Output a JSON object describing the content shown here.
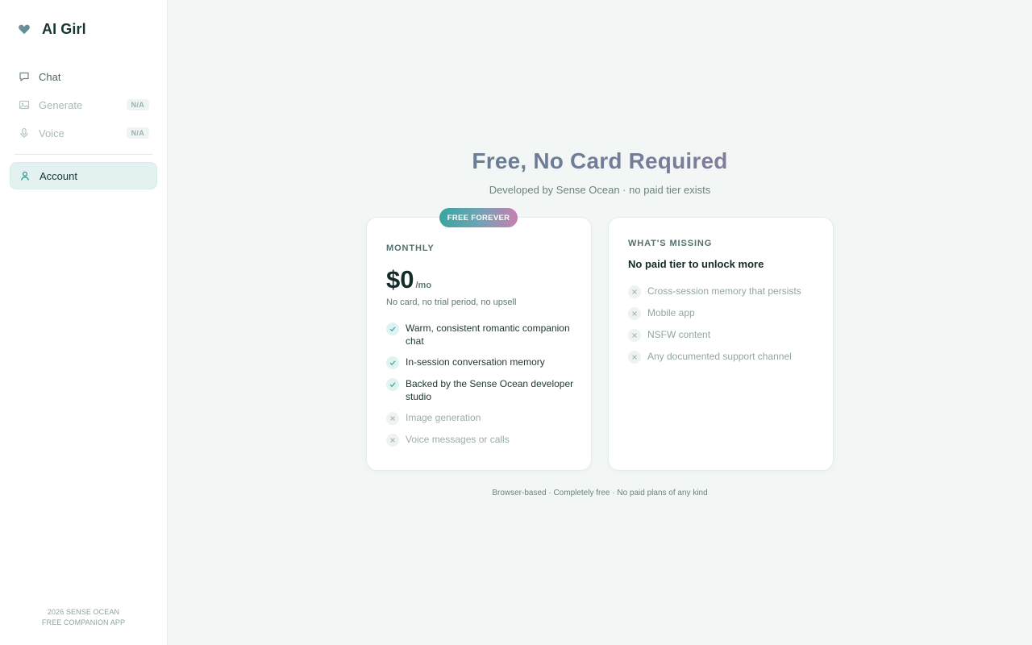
{
  "brand": {
    "name": "AI Girl",
    "icon": "heart-icon"
  },
  "nav": {
    "items": [
      {
        "label": "Chat",
        "icon": "chat-icon",
        "badge": null,
        "disabled": false
      },
      {
        "label": "Generate",
        "icon": "image-icon",
        "badge": "N/A",
        "disabled": true
      },
      {
        "label": "Voice",
        "icon": "microphone-icon",
        "badge": "N/A",
        "disabled": true
      }
    ],
    "account": {
      "label": "Account",
      "icon": "user-icon",
      "active": true
    }
  },
  "sidebar_footer": {
    "line1": "2026 SENSE OCEAN",
    "line2": "FREE COMPANION APP"
  },
  "main": {
    "title": "Free, No Card Required",
    "subtitle": "Developed by Sense Ocean · no paid tier exists",
    "footer_note": "Browser-based · Completely free · No paid plans of any kind"
  },
  "plan_card": {
    "ribbon": "FREE FOREVER",
    "label": "MONTHLY",
    "price": "$0",
    "per": "/mo",
    "note": "No card, no trial period, no upsell",
    "features": [
      {
        "text": "Warm, consistent romantic companion chat",
        "included": true
      },
      {
        "text": "In-session conversation memory",
        "included": true
      },
      {
        "text": "Backed by the Sense Ocean developer studio",
        "included": true
      },
      {
        "text": "Image generation",
        "included": false
      },
      {
        "text": "Voice messages or calls",
        "included": false
      }
    ]
  },
  "missing_card": {
    "label": "WHAT'S MISSING",
    "heading": "No paid tier to unlock more",
    "items": [
      {
        "text": "Cross-session memory that persists"
      },
      {
        "text": "Mobile app"
      },
      {
        "text": "NSFW content"
      },
      {
        "text": "Any documented support channel"
      }
    ]
  },
  "colors": {
    "accent": "#3aa59f",
    "accent_pink": "#c77fb2",
    "background": "#f2f7f6",
    "active_nav": "#e3f1f0"
  }
}
